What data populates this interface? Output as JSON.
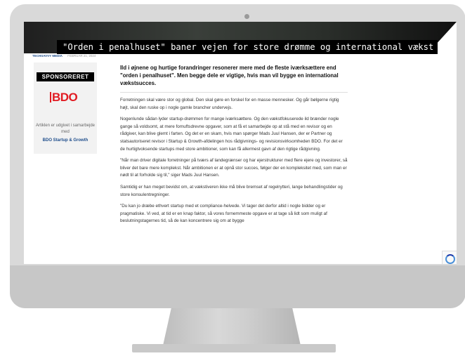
{
  "article": {
    "headline": "\"Orden i penalhuset\" baner vejen for store drømme og international vækst",
    "author": "TECHSAVVY MEDIA",
    "date": "FEBRUAR 21, 2024",
    "lead": "Ild i øjnene og hurtige forandringer resonerer mere med de fleste iværksættere end \"orden i penalhuset\". Men begge dele er vigtige, hvis man vil bygge en international vækstsucces.",
    "paragraphs": [
      "Forretningen skal være stor og global. Den skal gøre en forskel for en masse mennesker. Og går bølgerne rigtig højt, skal den ruske op i nogle gamle brancher undervejs.",
      "Nogenlunde sådan lyder startup-drømmen for mange iværksættere. Og den vækstfokuserede ild brænder nogle gange så voldsomt, at mere fornuftsdrevne opgaver, som at få et samarbejde op at stå med en revisor og en rådgiver, kan blive glemt i farten. Og det er en skam, hvis man spørger Mads Juul Hansen, der er Partner og statsautoriseret revisor i Startup & Growth-afdelingen hos rådgivnings- og revisionsvirksomheden BDO. For det er de hurtigtvoksende startups med store ambitioner, som kan få allermest gavn af den rigtige rådgivning.",
      "\"Når man driver digitale forretninger på tværs af landegrænser og har ejerstrukturer med flere ejere og investorer, så bliver det bare mere komplekst. Når ambitionen er at opnå stor succes, følger der en kompleksitet med, som man er nødt til at forholde sig til,\" siger Mads Juul Hansen.",
      "Samtidig er han meget bevidst om, at vækstiveren ikke må blive bremset af regelrytteri, lange behandlingstider og store konsulentregninger.",
      "\"Du kan jo dræbe ethvert startup med et compliance-helvede. Vi tager det derfor altid i nogle bidder og er pragmatiske. Vi ved, at tid er en knap faktor, så vores fornemmeste opgave er at tage så lidt som muligt af beslutningstagernes tid, så de kan koncentrere sig om at bygge"
    ]
  },
  "sidebar": {
    "sponsor_label": "SPONSORERET",
    "logo_text": "BDO",
    "note": "Artiklen er udgivet i samarbejde med",
    "partner_link": "BDO Startup & Growth"
  },
  "colors": {
    "accent_blue": "#1f4e8c",
    "bdo_red": "#e11b22"
  }
}
